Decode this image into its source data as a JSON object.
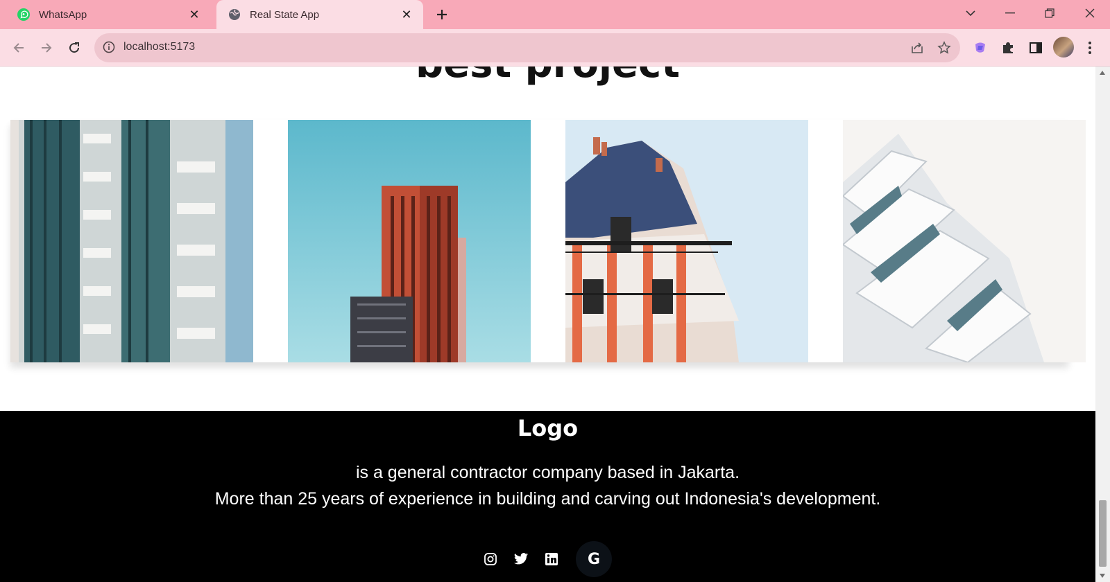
{
  "browser": {
    "tabs": [
      {
        "title": "WhatsApp",
        "icon": "whatsapp-icon",
        "active": false
      },
      {
        "title": "Real State App",
        "icon": "globe-icon",
        "active": true
      }
    ],
    "url": "localhost:5173"
  },
  "page": {
    "heading": "best project",
    "projects": [
      {
        "image": "apartment-balconies"
      },
      {
        "image": "red-tower"
      },
      {
        "image": "parisian-building"
      },
      {
        "image": "white-modern-building"
      }
    ]
  },
  "footer": {
    "logo": "Logo",
    "line1": "is a general contractor company based in Jakarta.",
    "line2": "More than 25 years of experience in building and carving out Indonesia's development.",
    "social": [
      "instagram-icon",
      "twitter-icon",
      "linkedin-icon",
      "google-icon"
    ],
    "google_letter": "G"
  },
  "colors": {
    "tabbar": "#f8a9b8",
    "toolbar": "#fbdde4",
    "footer": "#000000"
  }
}
